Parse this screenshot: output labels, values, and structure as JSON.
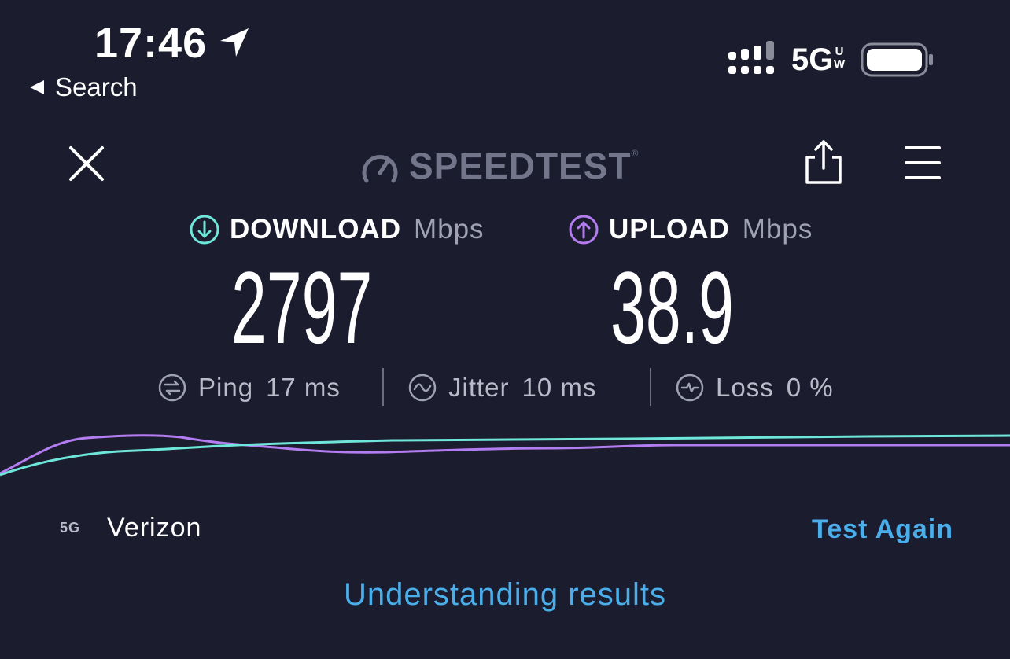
{
  "status_bar": {
    "time": "17:46",
    "back_label": "Search",
    "network_type": "5G",
    "network_sub": "U\nW"
  },
  "header": {
    "brand": "SPEEDTEST",
    "brand_mark": "®"
  },
  "download": {
    "label": "DOWNLOAD",
    "unit": "Mbps",
    "value": "2797",
    "color": "#6fe6da"
  },
  "upload": {
    "label": "UPLOAD",
    "unit": "Mbps",
    "value": "38.9",
    "color": "#b37cf0"
  },
  "stats": {
    "ping": {
      "label": "Ping",
      "value": "17 ms"
    },
    "jitter": {
      "label": "Jitter",
      "value": "10 ms"
    },
    "loss": {
      "label": "Loss",
      "value": "0 %"
    }
  },
  "connection": {
    "tech": "5G",
    "carrier": "Verizon"
  },
  "actions": {
    "test_again": "Test Again",
    "understanding": "Understanding results"
  },
  "icons": [
    "location-arrow-icon",
    "back-triangle-icon",
    "signal-icon",
    "battery-icon",
    "close-icon",
    "speedometer-icon",
    "share-icon",
    "menu-icon",
    "download-arrow-icon",
    "upload-arrow-icon",
    "ping-icon",
    "jitter-icon",
    "loss-icon"
  ]
}
